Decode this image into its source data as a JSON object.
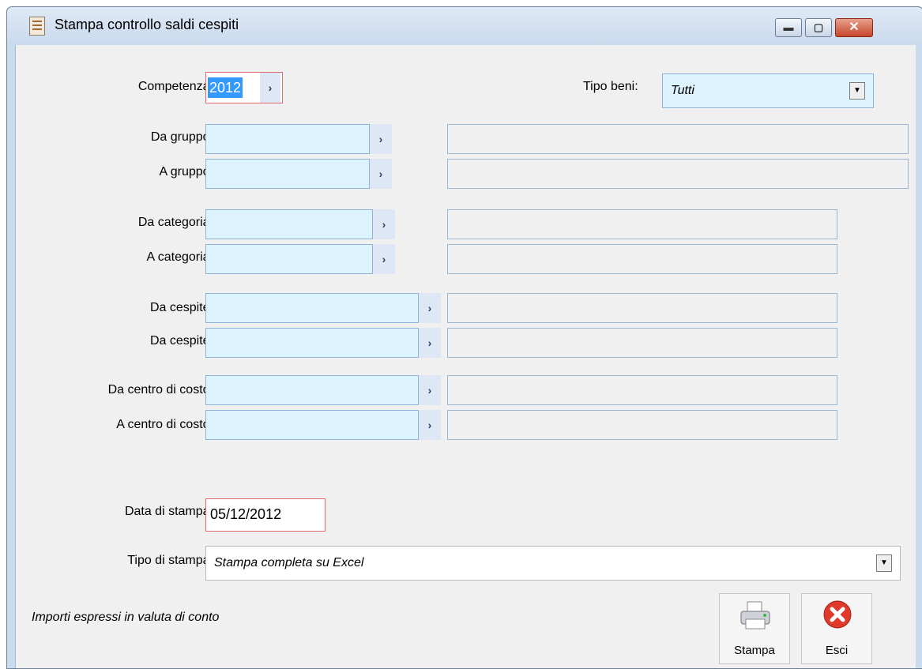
{
  "window": {
    "title": "Stampa controllo saldi cespiti",
    "controls": {
      "minimize_glyph": "▬",
      "maximize_glyph": "▢",
      "close_glyph": "✕"
    }
  },
  "form": {
    "competenza": {
      "label": "Competenza:",
      "value": "2012"
    },
    "tipo_beni": {
      "label": "Tipo beni:",
      "value": "Tutti"
    },
    "da_gruppo": {
      "label": "Da gruppo:",
      "value": "",
      "desc": ""
    },
    "a_gruppo": {
      "label": "A gruppo:",
      "value": "",
      "desc": ""
    },
    "da_categoria": {
      "label": "Da categoria:",
      "value": "",
      "desc": ""
    },
    "a_categoria": {
      "label": "A categoria:",
      "value": "",
      "desc": ""
    },
    "da_cespite": {
      "label": "Da cespite:",
      "value": "",
      "desc": ""
    },
    "a_cespite": {
      "label": "Da cespite:",
      "value": "",
      "desc": ""
    },
    "da_centro": {
      "label": "Da centro di costo:",
      "value": "",
      "desc": ""
    },
    "a_centro": {
      "label": "A centro di costo:",
      "value": "",
      "desc": ""
    },
    "data_stampa": {
      "label": "Data di stampa:",
      "value": "05/12/2012"
    },
    "tipo_stampa": {
      "label": "Tipo di stampa:",
      "value": "Stampa completa su Excel"
    }
  },
  "footer": {
    "note": "Importi espressi in valuta di conto",
    "stampa_label": "Stampa",
    "esci_label": "Esci"
  },
  "icons": {
    "zoom": "chevron-right-icon",
    "printer": "printer-icon",
    "exit": "close-circle-icon"
  },
  "colors": {
    "field_bg": "#ddf3fd",
    "required_border": "#e06a6a",
    "exit_red": "#e0382b"
  }
}
